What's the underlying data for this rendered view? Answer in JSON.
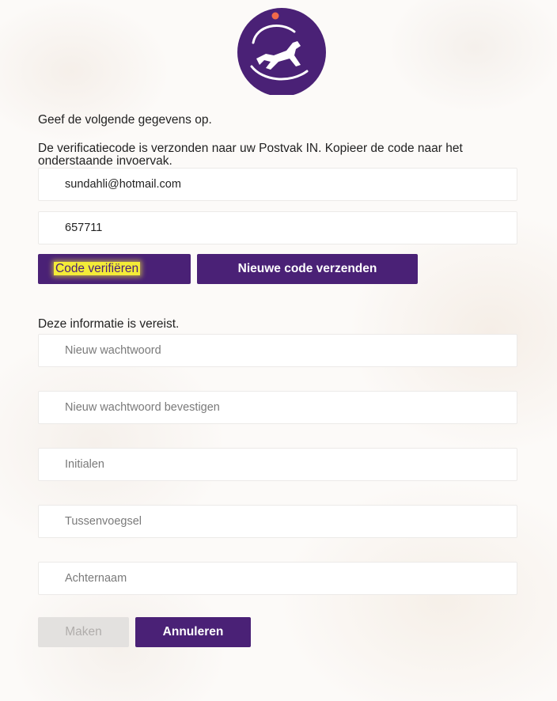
{
  "brand": {
    "logo_icon": "running-dog-logo-icon",
    "primary_color": "#4a2176",
    "accent_dot_color": "#f06a4a",
    "highlight_color": "#f4ec38"
  },
  "form": {
    "instructions": "Geef de volgende gegevens op.",
    "verification_message": "De verificatiecode is verzonden naar uw Postvak IN. Kopieer de code naar het onderstaande invoervak.",
    "email_value": "sundahli@hotmail.com",
    "code_value": "657711",
    "verify_button_label": "Code verifiëren",
    "resend_button_label": "Nieuwe code verzenden",
    "required_message": "Deze informatie is vereist.",
    "new_password_placeholder": "Nieuw wachtwoord",
    "confirm_password_placeholder": "Nieuw wachtwoord bevestigen",
    "initials_placeholder": "Initialen",
    "infix_placeholder": "Tussenvoegsel",
    "surname_placeholder": "Achternaam",
    "create_button_label": "Maken",
    "cancel_button_label": "Annuleren"
  }
}
